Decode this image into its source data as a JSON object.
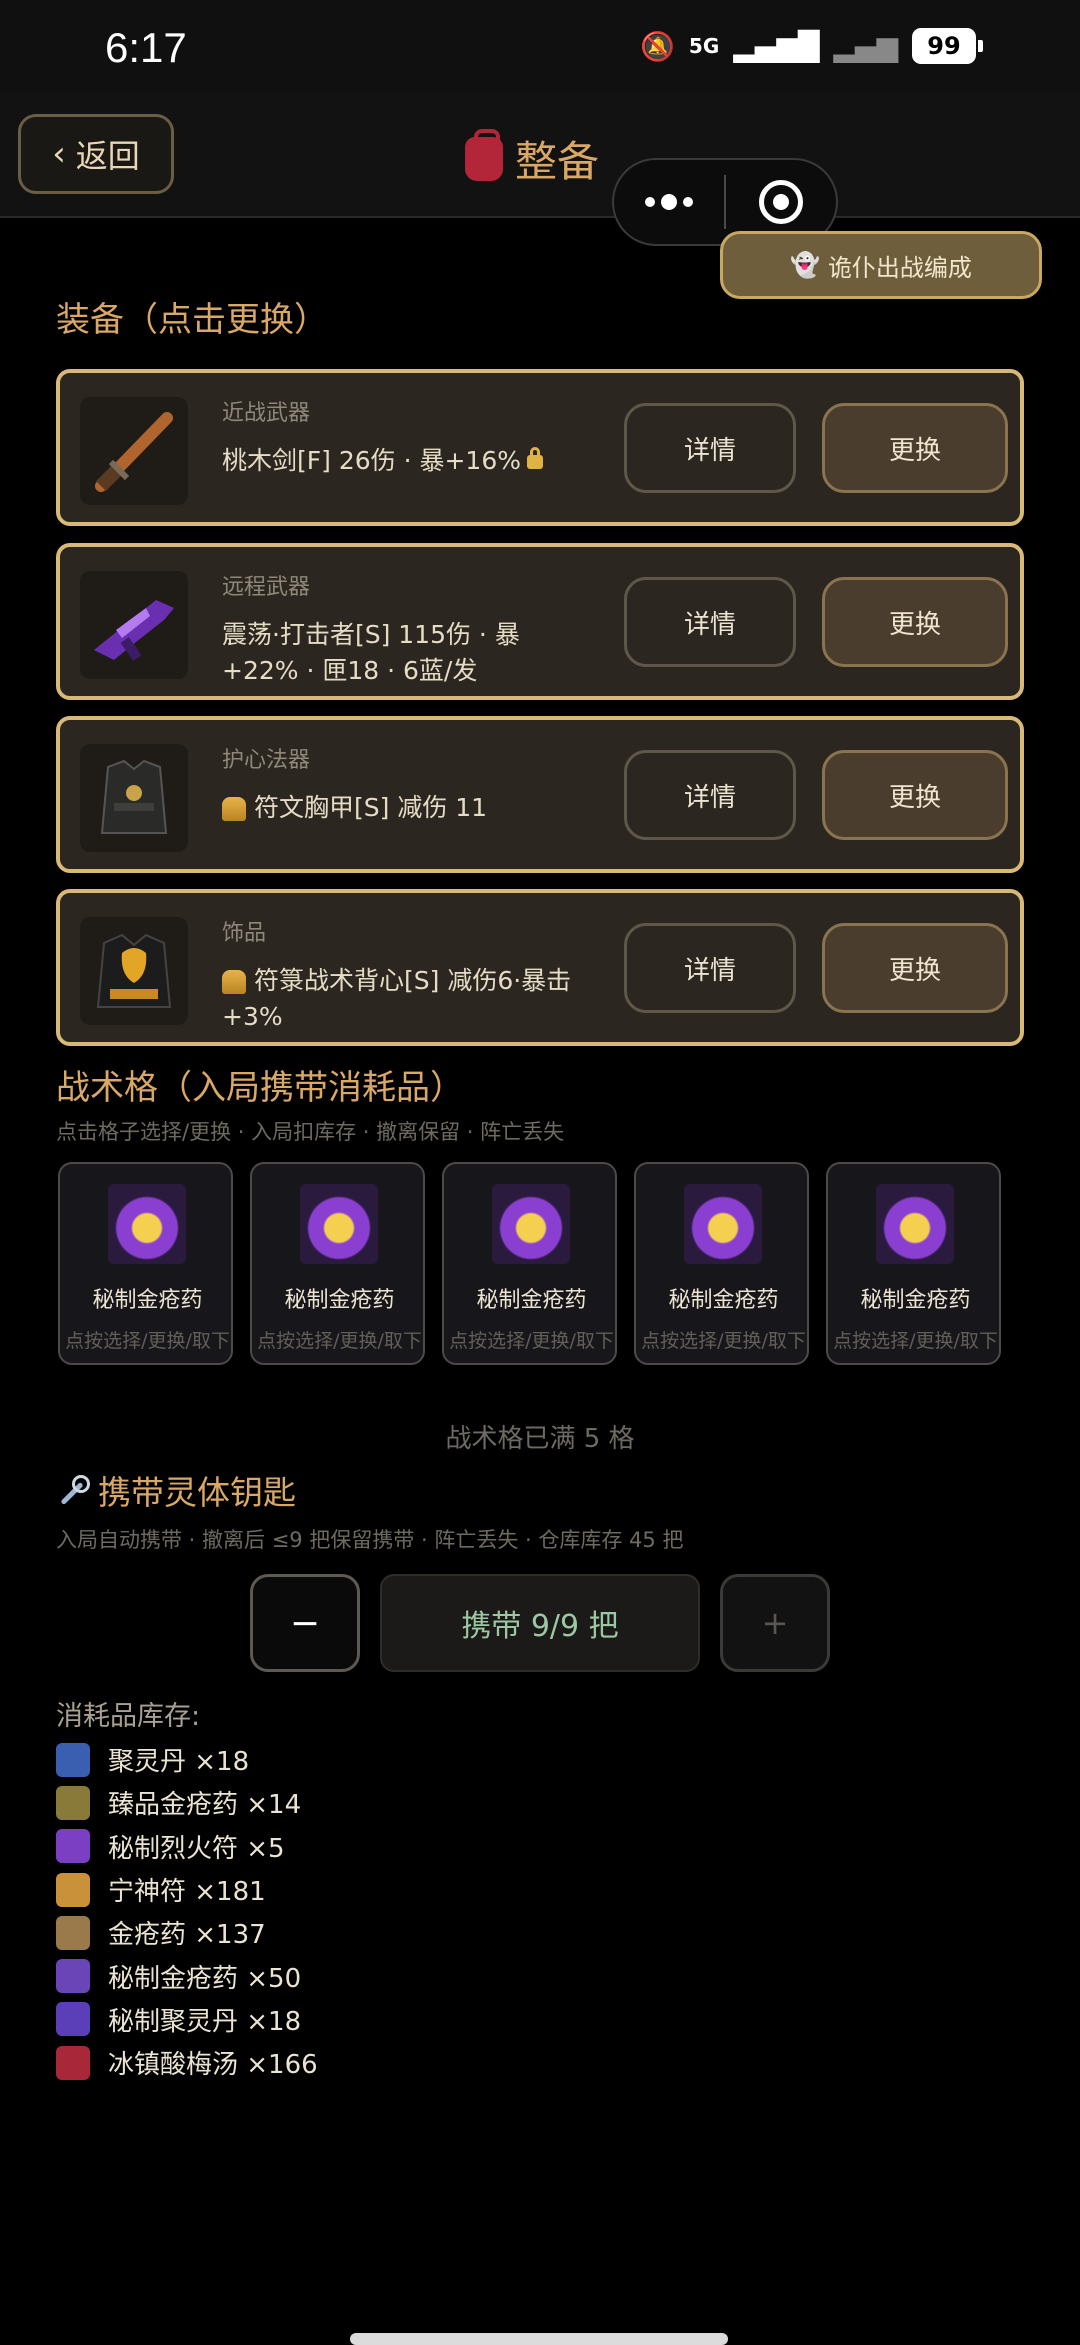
{
  "status_bar": {
    "time": "6:17",
    "signal_label": "5G",
    "battery": "99"
  },
  "header": {
    "back_label": "返回",
    "title": "整备"
  },
  "ghost_button_label": "诡仆出战编成",
  "equipment": {
    "section_title": "装备（点击更换）",
    "detail_label": "详情",
    "change_label": "更换",
    "items": [
      {
        "slot": "近战武器",
        "name": "桃木剑[F]  26伤 · 暴+16%",
        "locked": true,
        "rarity_icon": false,
        "icon": "sword-icon"
      },
      {
        "slot": "远程武器",
        "name": "震荡·打击者[S]  115伤 · 暴+22% · 匣18 · 6蓝/发",
        "locked": false,
        "rarity_icon": false,
        "icon": "gun-icon"
      },
      {
        "slot": "护心法器",
        "name": "符文胸甲[S]  减伤 11",
        "locked": false,
        "rarity_icon": true,
        "icon": "chest-armor-icon"
      },
      {
        "slot": "饰品",
        "name": "符箓战术背心[S]  减伤6·暴击+3%",
        "locked": false,
        "rarity_icon": true,
        "icon": "vest-icon"
      }
    ]
  },
  "tactical": {
    "section_title": "战术格（入局携带消耗品）",
    "note": "点击格子选择/更换 · 入局扣库存 · 撤离保留 · 阵亡丢失",
    "slots": [
      {
        "name": "秘制金疮药",
        "hint": "点按选择/更换/取下"
      },
      {
        "name": "秘制金疮药",
        "hint": "点按选择/更换/取下"
      },
      {
        "name": "秘制金疮药",
        "hint": "点按选择/更换/取下"
      },
      {
        "name": "秘制金疮药",
        "hint": "点按选择/更换/取下"
      },
      {
        "name": "秘制金疮药",
        "hint": "点按选择/更换/取下"
      }
    ],
    "full_text": "战术格已满 5 格"
  },
  "keys": {
    "title": "携带灵体钥匙",
    "note": "入局自动携带 · 撤离后 ≤9 把保留携带 · 阵亡丢失 · 仓库库存 45 把",
    "minus": "−",
    "value": "携带 9/9 把",
    "plus": "+"
  },
  "inventory": {
    "title": "消耗品库存:",
    "items": [
      {
        "name": "聚灵丹 ×18",
        "color": "#3b5fb0"
      },
      {
        "name": "臻品金疮药 ×14",
        "color": "#8a7a3a"
      },
      {
        "name": "秘制烈火符 ×5",
        "color": "#7b3fc4"
      },
      {
        "name": "宁神符 ×181",
        "color": "#c9913a"
      },
      {
        "name": "金疮药 ×137",
        "color": "#9a7a4a"
      },
      {
        "name": "秘制金疮药 ×50",
        "color": "#6a45b8"
      },
      {
        "name": "秘制聚灵丹 ×18",
        "color": "#5a3fb8"
      },
      {
        "name": "冰镇酸梅汤 ×166",
        "color": "#a8283a"
      }
    ]
  }
}
